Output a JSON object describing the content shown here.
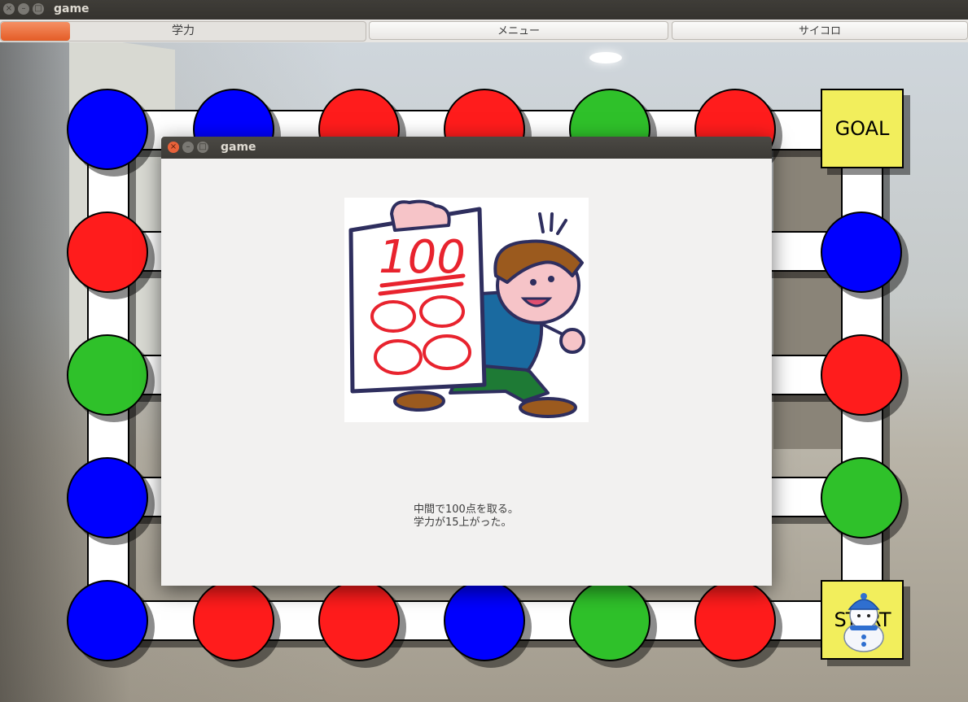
{
  "window": {
    "title": "game",
    "controls": [
      "×",
      "–",
      "□"
    ]
  },
  "toolbar": {
    "progress_label": "学力",
    "progress_value": 0.19,
    "menu_button": "メニュー",
    "dice_button": "サイコロ"
  },
  "board": {
    "goal_label": "GOAL",
    "start_label": "START",
    "colors": {
      "blue": "#0000ff",
      "red": "#ff1c1c",
      "green": "#2fc12a",
      "square": "#f2ee5c"
    },
    "top_row": [
      "blue",
      "blue",
      "red",
      "red",
      "green",
      "red"
    ],
    "left_column": [
      "red",
      "green",
      "blue"
    ],
    "right_column": [
      "blue",
      "red",
      "green"
    ],
    "bottom_row": [
      "blue",
      "red",
      "red",
      "blue",
      "green",
      "red"
    ],
    "player_icon": "snowman-icon"
  },
  "dialog": {
    "title": "game",
    "controls": [
      "×",
      "–",
      "□"
    ],
    "image_icon": "boy-holding-100-test-icon",
    "image_score": "100",
    "message_line1": "中間で100点を取る。",
    "message_line2": "学力が15上がった。"
  }
}
